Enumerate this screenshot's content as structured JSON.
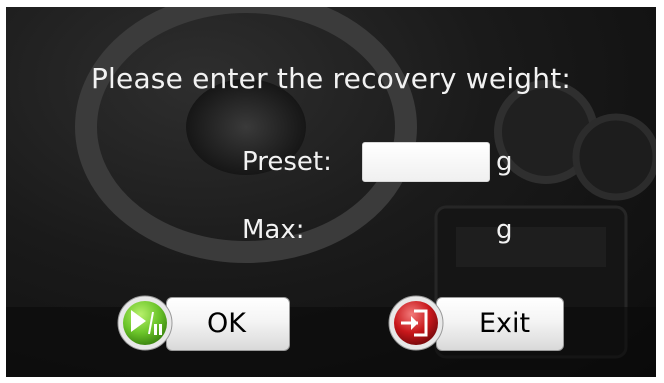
{
  "prompt": "Please enter the recovery weight:",
  "preset": {
    "label": "Preset:",
    "value": "",
    "unit": "g"
  },
  "max": {
    "label": "Max:",
    "value": "",
    "unit": "g"
  },
  "buttons": {
    "ok_label": "OK",
    "exit_label": "Exit"
  },
  "icons": {
    "ok": "play-pause-icon",
    "exit": "exit-door-icon"
  },
  "colors": {
    "ok_icon": "#6cc52a",
    "exit_icon": "#c8171b",
    "text": "#f2f2f2"
  }
}
